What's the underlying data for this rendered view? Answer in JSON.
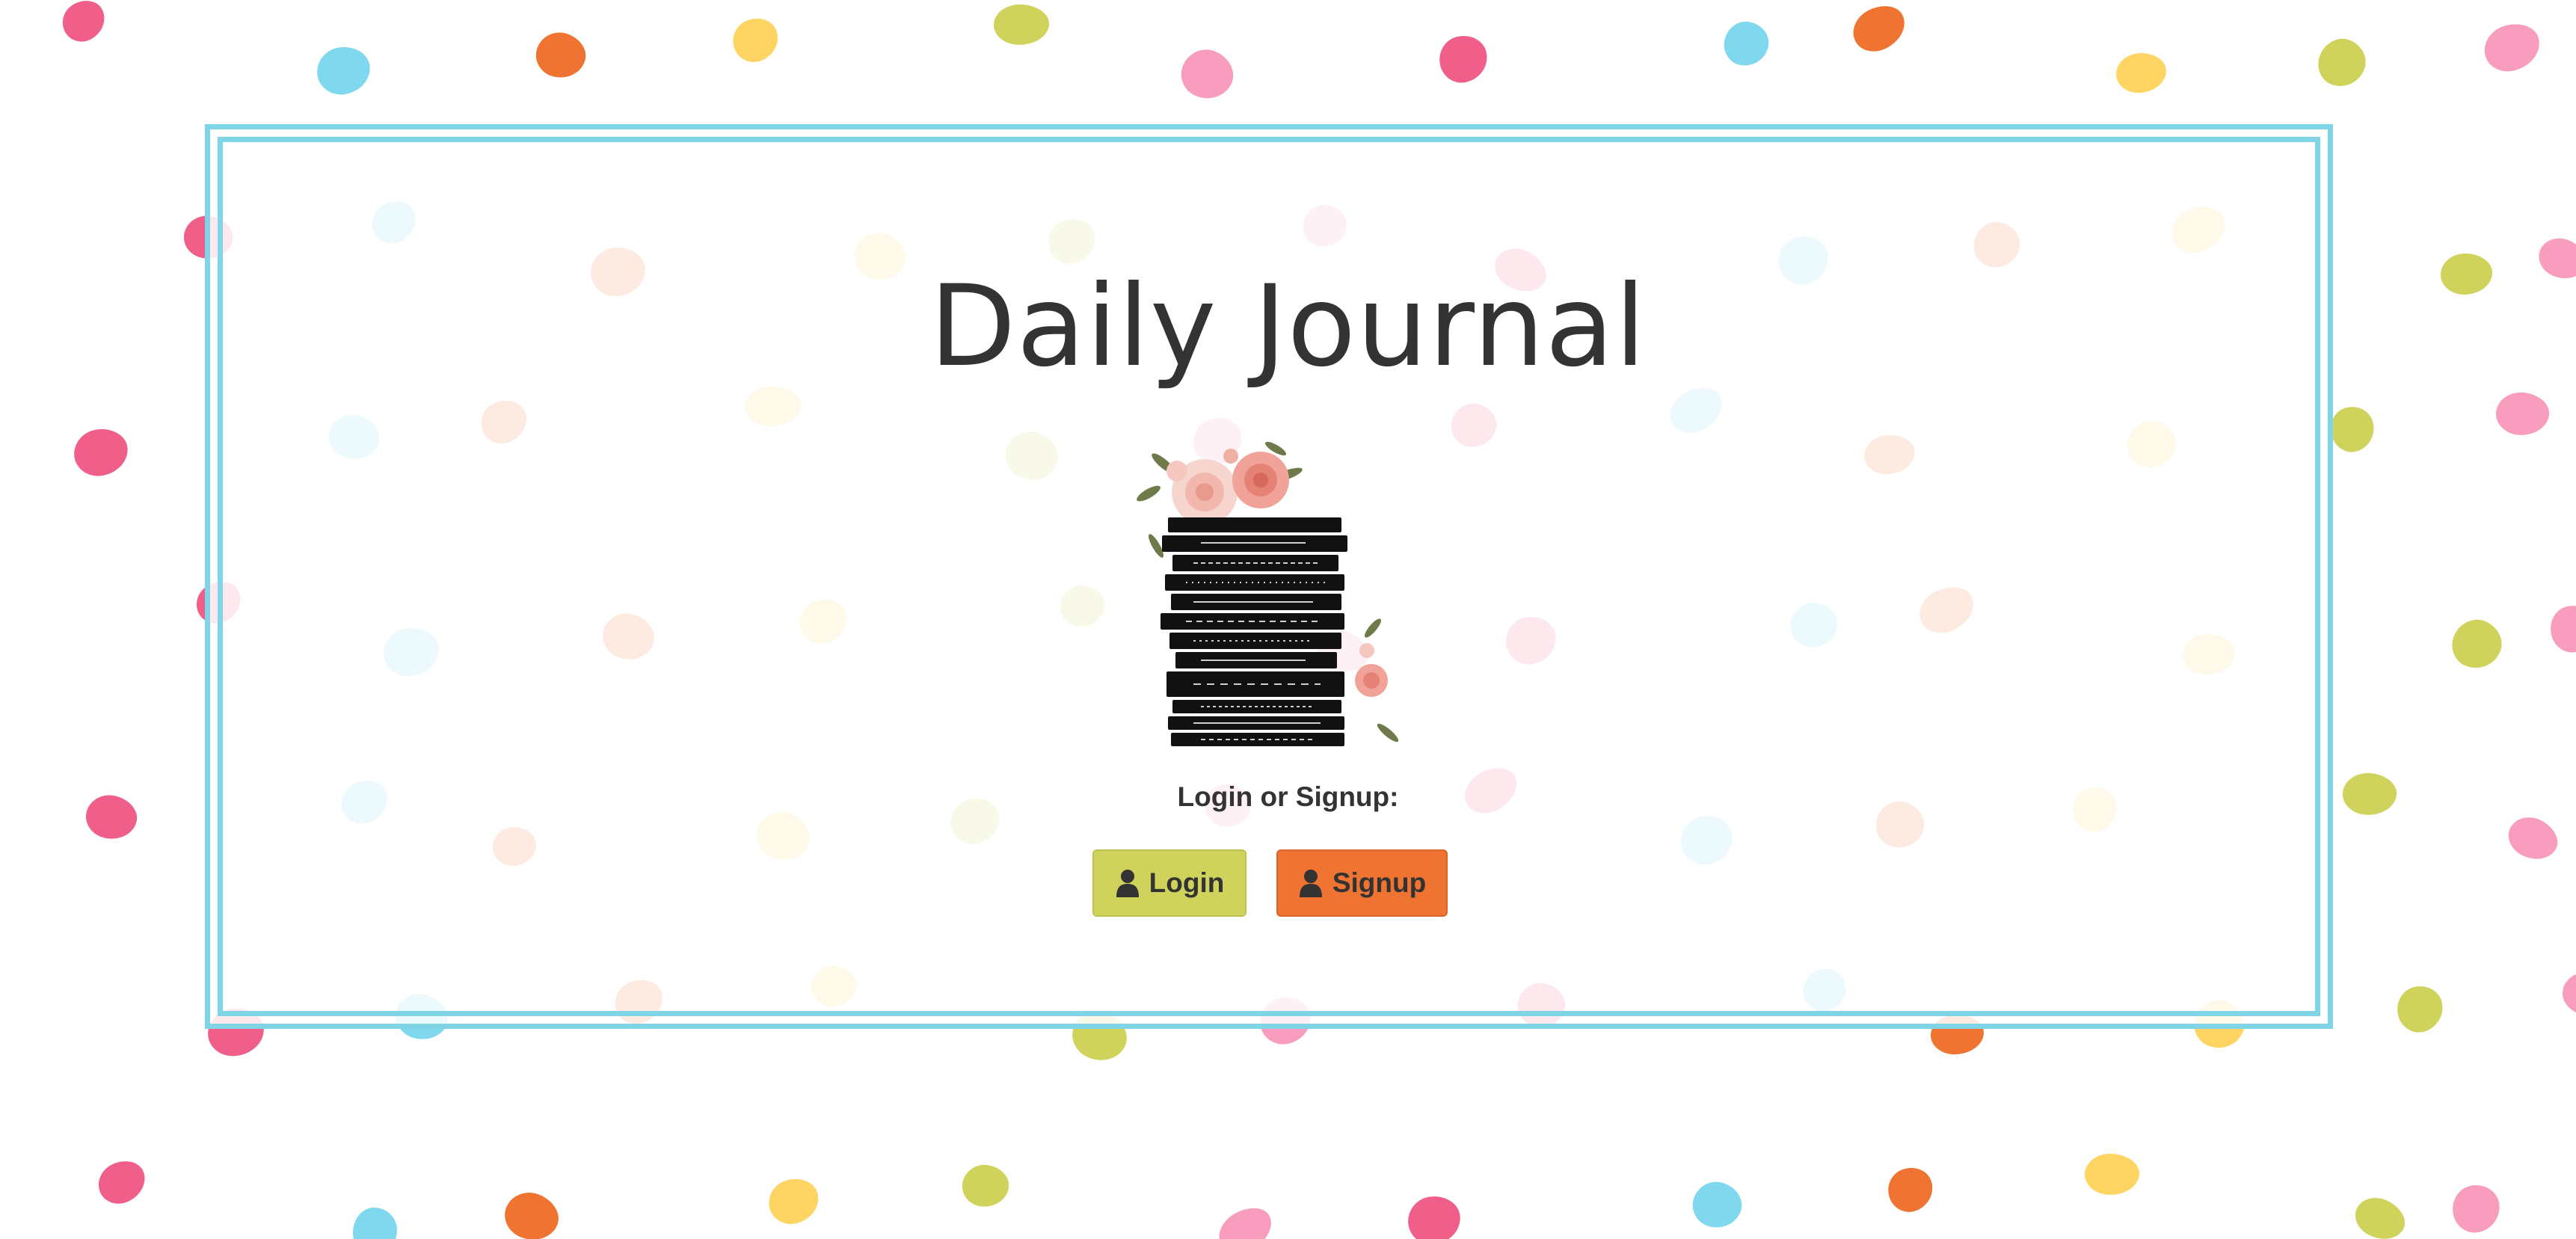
{
  "app": {
    "title": "Daily Journal"
  },
  "auth": {
    "prompt": "Login or Signup:",
    "login_label": "Login",
    "signup_label": "Signup",
    "login_icon": "user-icon",
    "signup_icon": "user-icon"
  },
  "theme": {
    "frame_color": "#7fd4e6",
    "login_color": "#cfd35c",
    "signup_color": "#ef7431",
    "dot_colors": [
      "#ef5f8a",
      "#7fd8ee",
      "#ef7431",
      "#fed563",
      "#cfd35c",
      "#f89dbd"
    ]
  }
}
